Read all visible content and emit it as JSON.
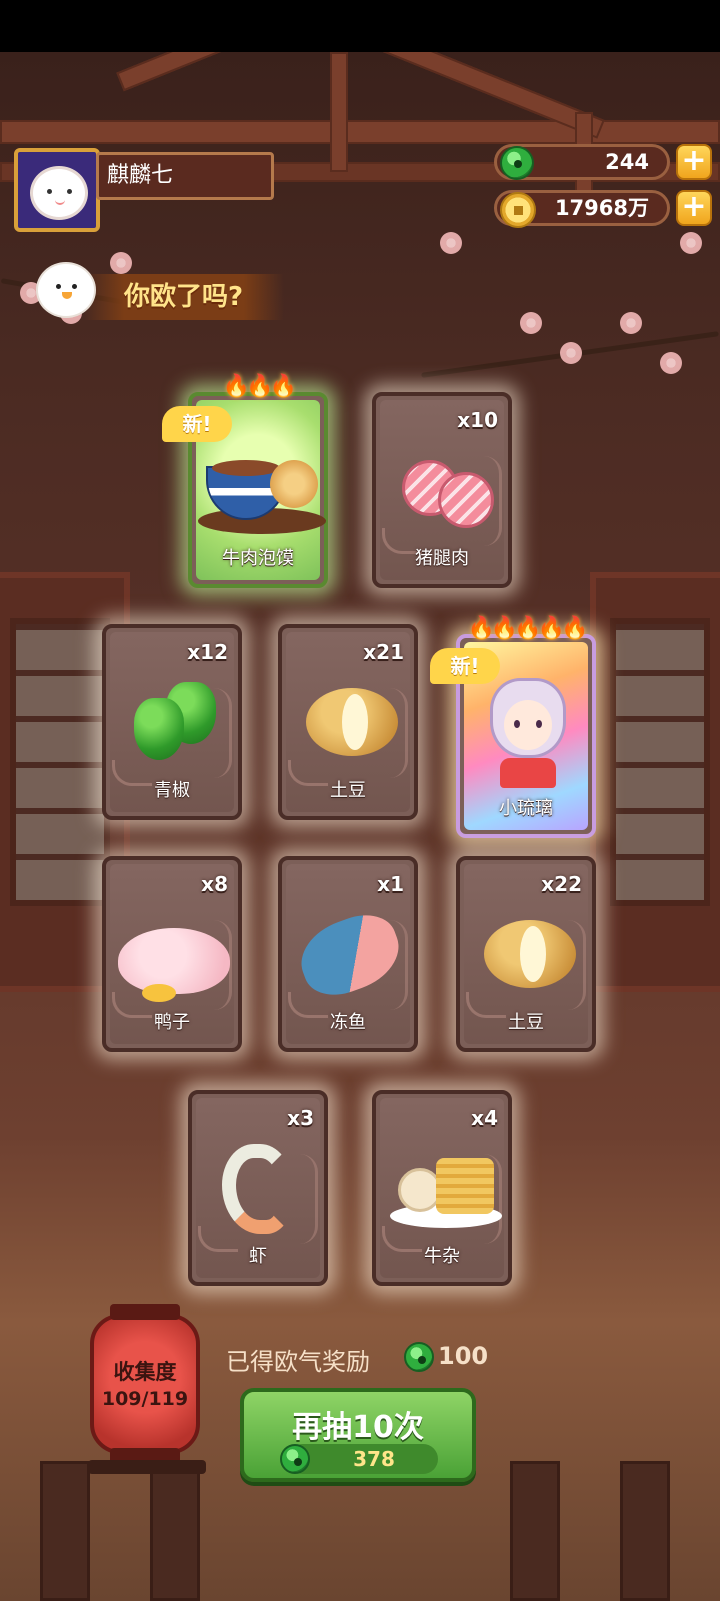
{
  "player": {
    "name": "麒麟七"
  },
  "currency": {
    "jade": "244",
    "gold": "17968万"
  },
  "title": "你欧了吗?",
  "cards": [
    {
      "label": "牛肉泡馍",
      "qty": "",
      "new_tag": "新!",
      "flames": "🔥🔥🔥"
    },
    {
      "label": "猪腿肉",
      "qty": "x10"
    },
    {
      "label": "青椒",
      "qty": "x12"
    },
    {
      "label": "土豆",
      "qty": "x21"
    },
    {
      "label": "小琉璃",
      "qty": "",
      "new_tag": "新!",
      "flames": "🔥🔥🔥🔥🔥"
    },
    {
      "label": "鸭子",
      "qty": "x8"
    },
    {
      "label": "冻鱼",
      "qty": "x1"
    },
    {
      "label": "土豆",
      "qty": "x22"
    },
    {
      "label": "虾",
      "qty": "x3"
    },
    {
      "label": "牛杂",
      "qty": "x4"
    }
  ],
  "collection": {
    "label": "收集度",
    "progress": "109/119"
  },
  "reward": {
    "label": "已得欧气奖励",
    "value": "100"
  },
  "draw_button": {
    "label": "再抽10次",
    "cost": "378"
  }
}
